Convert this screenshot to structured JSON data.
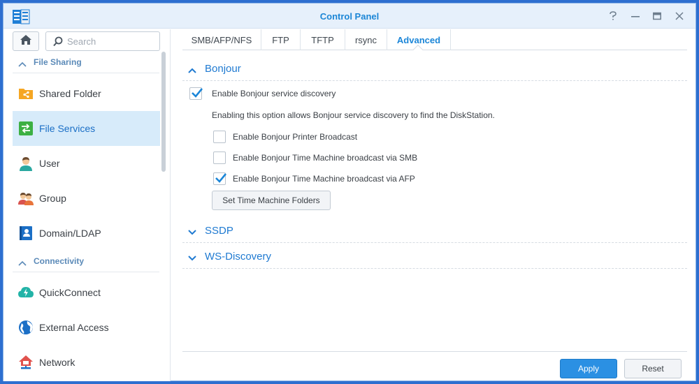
{
  "window": {
    "title": "Control Panel",
    "help_icon": "help-icon",
    "minimize_icon": "minimize-icon",
    "maximize_icon": "maximize-icon",
    "close_icon": "close-icon",
    "accent": "#1c86d6"
  },
  "sidebar": {
    "home_icon": "home-icon",
    "search": {
      "placeholder": "Search"
    },
    "groups": [
      {
        "label": "File Sharing",
        "items": [
          {
            "label": "Shared Folder",
            "icon": "shared-folder-icon",
            "active": false
          },
          {
            "label": "File Services",
            "icon": "file-services-icon",
            "active": true
          },
          {
            "label": "User",
            "icon": "user-icon",
            "active": false
          },
          {
            "label": "Group",
            "icon": "group-icon",
            "active": false
          },
          {
            "label": "Domain/LDAP",
            "icon": "domain-ldap-icon",
            "active": false
          }
        ]
      },
      {
        "label": "Connectivity",
        "items": [
          {
            "label": "QuickConnect",
            "icon": "quickconnect-icon",
            "active": false
          },
          {
            "label": "External Access",
            "icon": "external-access-icon",
            "active": false
          },
          {
            "label": "Network",
            "icon": "network-icon",
            "active": false
          }
        ]
      }
    ]
  },
  "tabs": [
    {
      "label": "SMB/AFP/NFS",
      "active": false
    },
    {
      "label": "FTP",
      "active": false
    },
    {
      "label": "TFTP",
      "active": false
    },
    {
      "label": "rsync",
      "active": false
    },
    {
      "label": "Advanced",
      "active": true
    }
  ],
  "sections": {
    "bonjour": {
      "title": "Bonjour",
      "expanded": true,
      "enable_label": "Enable Bonjour service discovery",
      "enable_checked": true,
      "description": "Enabling this option allows Bonjour service discovery to find the DiskStation.",
      "options": [
        {
          "label": "Enable Bonjour Printer Broadcast",
          "checked": false
        },
        {
          "label": "Enable Bonjour Time Machine broadcast via SMB",
          "checked": false
        },
        {
          "label": "Enable Bonjour Time Machine broadcast via AFP",
          "checked": true
        }
      ],
      "time_machine_button": "Set Time Machine Folders"
    },
    "ssdp": {
      "title": "SSDP",
      "expanded": false
    },
    "ws_discovery": {
      "title": "WS-Discovery",
      "expanded": false
    }
  },
  "footer": {
    "apply_label": "Apply",
    "reset_label": "Reset"
  },
  "colors": {
    "primary_button": "#2b90e3",
    "active_nav_bg": "#d7ebfa",
    "section_title": "#1f7ad1",
    "desktop_bg": "#2e6fd0"
  }
}
